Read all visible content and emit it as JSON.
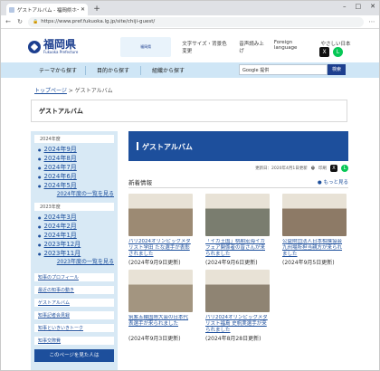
{
  "browser": {
    "tab_title": "ゲストアルバム - 福岡県ホームページ",
    "new_tab": "+",
    "url": "https://www.pref.fukuoka.lg.jp/site/chiji-guest/"
  },
  "header": {
    "logo_text": "福岡県",
    "logo_sub": "Fukuoka Prefecture",
    "banner_text": "福岡県",
    "utils": [
      "文字サイズ・背景色変更",
      "音声読み上げ",
      "Foreign language",
      "やさしい日本語"
    ]
  },
  "nav": {
    "items": [
      "テーマから探す",
      "目的から探す",
      "組織から探す"
    ],
    "search_placeholder": "Google 提供",
    "search_button": "検索"
  },
  "breadcrumb": {
    "home": "トップページ",
    "sep": " > ",
    "current": "ゲストアルバム"
  },
  "page_title": "ゲストアルバム",
  "sidebar": {
    "year1": "2024年度",
    "year1_months": [
      "2024年9月",
      "2024年8月",
      "2024年7月",
      "2024年6月",
      "2024年5月"
    ],
    "year1_all": "2024年度の一覧を見る",
    "year2": "2023年度",
    "year2_months": [
      "2024年3月",
      "2024年2月",
      "2024年1月",
      "2023年12月",
      "2023年11月"
    ],
    "year2_all": "2023年度の一覧を見る",
    "links": [
      "知事のプロフィール",
      "最近の知事の動き",
      "ゲストアルバム",
      "知事記者会見録",
      "知事といきいきトーク",
      "知事交際費"
    ],
    "bottom": "このページを見た人は"
  },
  "main": {
    "heading": "ゲストアルバム",
    "updated": "更新日：2020年4月1日更新",
    "print": "印刷",
    "news_title": "新着情報",
    "more": "もっと見る",
    "cards": [
      {
        "title": "パリ2024オリンピックメダリスト学田 たな選手が表彰されました",
        "date": "(2024年9月9日更新)",
        "color": "#9c8a73"
      },
      {
        "title": "「イカ王国」桃期宏海イカフェア関係者の皆さんが来られました",
        "date": "(2024年9月6日更新)",
        "color": "#7a7d6f"
      },
      {
        "title": "公益財団法人日本相撲協会九州場所担当親方が来られました",
        "date": "(2024年9月5日更新)",
        "color": "#8d7a66"
      },
      {
        "title": "筑紫五輪国際大会の日本代表選手が来られました",
        "date": "(2024年9月3日更新)",
        "color": "#a39580"
      },
      {
        "title": "パリ2024オリンピックメダリスト福島 史帆実選手が来られました",
        "date": "(2024年8月28日更新)",
        "color": "#8f8473"
      }
    ]
  }
}
